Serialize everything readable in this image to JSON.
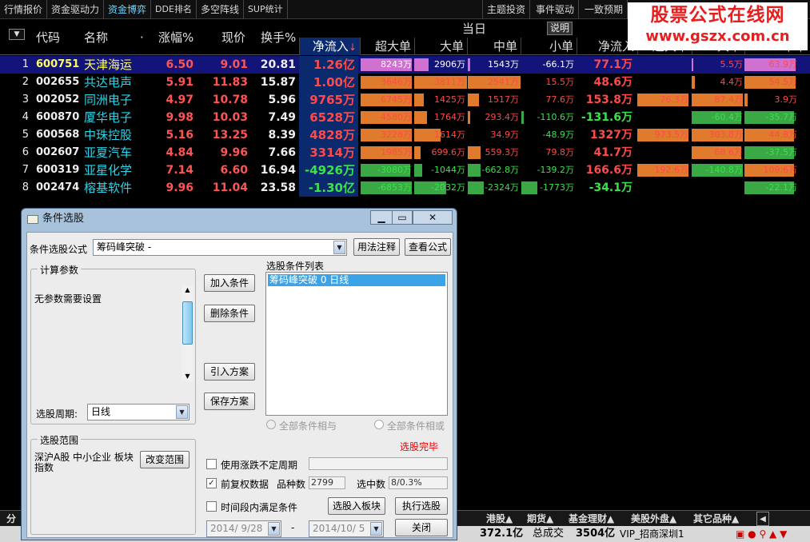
{
  "top_tabs": [
    "行情报价",
    "资金驱动力",
    "资金博弈",
    "DDE排名",
    "多空阵线",
    "SUP统计"
  ],
  "active_tab": "资金博弈",
  "right_tabs": [
    "主题投资",
    "事件驱动",
    "一致预期"
  ],
  "logo": {
    "line1": "股票公式在线网",
    "line2": "www.gszx.com.cn"
  },
  "headers": {
    "code": "代码",
    "name": "名称",
    "pct": "涨幅%",
    "price": "现价",
    "turnover": "换手%",
    "today": "当日",
    "net_inflow": "净流入",
    "super_large": "超大单",
    "large": "大单",
    "medium": "中单",
    "small": "小单",
    "net_inflow2": "净流入",
    "super_large2": "超大单",
    "large2": "大单",
    "medium2": "中单",
    "explain": "说明"
  },
  "rows": [
    {
      "idx": "1",
      "code": "600751",
      "name": "天津海运",
      "pct": "6.50",
      "price": "9.01",
      "turn": "20.81",
      "net": "1.26亿",
      "net_c": "r",
      "sl": "8243万",
      "sl_c": "w",
      "lg": "2906万",
      "lg_c": "w",
      "md": "1543万",
      "md_c": "w",
      "sm": "-66.1万",
      "sm_c": "w",
      "net2": "77.1万",
      "net2_c": "r",
      "sl2": "",
      "lg2": "5.5万",
      "md2": "63.9万"
    },
    {
      "idx": "2",
      "code": "002655",
      "name": "共达电声",
      "pct": "5.91",
      "price": "11.83",
      "turn": "15.87",
      "net": "1.00亿",
      "net_c": "r",
      "sl": "3646万",
      "sl_c": "r",
      "lg": "3811万",
      "lg_c": "r",
      "md": "2541万",
      "md_c": "r",
      "sm": "15.5万",
      "sm_c": "r",
      "net2": "48.6万",
      "net2_c": "r",
      "sl2": "",
      "lg2": "4.4万",
      "md2": "54.5万"
    },
    {
      "idx": "3",
      "code": "002052",
      "name": "同洲电子",
      "pct": "4.97",
      "price": "10.78",
      "turn": "5.96",
      "net": "9765万",
      "net_c": "r",
      "sl": "6745万",
      "sl_c": "r",
      "lg": "1425万",
      "lg_c": "r",
      "md": "1517万",
      "md_c": "r",
      "sm": "77.6万",
      "sm_c": "r",
      "net2": "153.8万",
      "net2_c": "r",
      "sl2": "76.3万",
      "lg2": "87.4万",
      "md2": "3.9万"
    },
    {
      "idx": "4",
      "code": "600870",
      "name": "厦华电子",
      "pct": "9.98",
      "price": "10.03",
      "turn": "7.49",
      "net": "6528万",
      "net_c": "r",
      "sl": "4580万",
      "sl_c": "r",
      "lg": "1764万",
      "lg_c": "r",
      "md": "293.4万",
      "md_c": "r",
      "sm": "-110.6万",
      "sm_c": "g",
      "net2": "-131.6万",
      "net2_c": "g",
      "sl2": "",
      "lg2": "-60.4万",
      "md2": "-35.7万"
    },
    {
      "idx": "5",
      "code": "600568",
      "name": "中珠控股",
      "pct": "5.16",
      "price": "13.25",
      "turn": "8.39",
      "net": "4828万",
      "net_c": "r",
      "sl": "3228万",
      "sl_c": "r",
      "lg": "1614万",
      "lg_c": "r",
      "md": "34.9万",
      "md_c": "r",
      "sm": "-48.9万",
      "sm_c": "g",
      "net2": "1327万",
      "net2_c": "r",
      "sl2": "973.5万",
      "lg2": "303.8万",
      "md2": "44.8万"
    },
    {
      "idx": "6",
      "code": "002607",
      "name": "亚夏汽车",
      "pct": "4.84",
      "price": "9.96",
      "turn": "7.66",
      "net": "3314万",
      "net_c": "r",
      "sl": "1985万",
      "sl_c": "r",
      "lg": "699.6万",
      "lg_c": "r",
      "md": "559.3万",
      "md_c": "r",
      "sm": "79.8万",
      "sm_c": "r",
      "net2": "41.7万",
      "net2_c": "r",
      "sl2": "",
      "lg2": "68.6万",
      "md2": "-37.5万"
    },
    {
      "idx": "7",
      "code": "600319",
      "name": "亚星化学",
      "pct": "7.14",
      "price": "6.60",
      "turn": "16.94",
      "net": "-4926万",
      "net_c": "g",
      "sl": "-3080万",
      "sl_c": "g",
      "lg": "-1044万",
      "lg_c": "g",
      "md": "-662.8万",
      "md_c": "g",
      "sm": "-139.2万",
      "sm_c": "g",
      "net2": "166.6万",
      "net2_c": "r",
      "sl2": "192.6万",
      "lg2": "-140.8万",
      "md2": "109.6万"
    },
    {
      "idx": "8",
      "code": "002474",
      "name": "榕基软件",
      "pct": "9.96",
      "price": "11.04",
      "turn": "23.58",
      "net": "-1.30亿",
      "net_c": "g",
      "sl": "-6853万",
      "sl_c": "g",
      "lg": "-2032万",
      "lg_c": "g",
      "md": "-2324万",
      "md_c": "g",
      "sm": "-1773万",
      "sm_c": "g",
      "net2": "-34.1万",
      "net2_c": "g",
      "sl2": "",
      "lg2": "",
      "md2": "-22.1万"
    }
  ],
  "bottom_tabs": [
    "分",
    "港股▲",
    "期货▲",
    "基金理财▲",
    "美股外盘▲",
    "其它品种▲"
  ],
  "status": {
    "v1": "372.1亿",
    "label": "总成交",
    "v2": "3504亿",
    "broker": "VIP_招商深圳1"
  },
  "dialog": {
    "title": "条件选股",
    "formula_label": "条件选股公式",
    "formula_value": "筹码峰突破 -",
    "usage_btn": "用法注释",
    "view_btn": "查看公式",
    "params_title": "计算参数",
    "params_text": "无参数需要设置",
    "add_btn": "加入条件",
    "del_btn": "删除条件",
    "import_btn": "引入方案",
    "save_btn": "保存方案",
    "list_title": "选股条件列表",
    "list_item": "筹码峰突破  0  日线",
    "period_label": "选股周期:",
    "period_value": "日线",
    "and_label": "全部条件相与",
    "or_label": "全部条件相或",
    "done_text": "选股完毕",
    "scope_title": "选股范围",
    "scope_text": "深沪A股 中小企业 板块指数",
    "change_scope_btn": "改变范围",
    "use_uncertain": "使用涨跌不定周期",
    "pre_adjust": "前复权数据",
    "count_label": "品种数",
    "count_value": "2799",
    "selected_label": "选中数",
    "selected_value": "8/0.3%",
    "time_cond": "时间段内满足条件",
    "to_block_btn": "选股入板块",
    "run_btn": "执行选股",
    "close_btn": "关闭",
    "date_from": "2014/ 9/28",
    "date_to": "2014/10/ 5",
    "dash": "-"
  }
}
